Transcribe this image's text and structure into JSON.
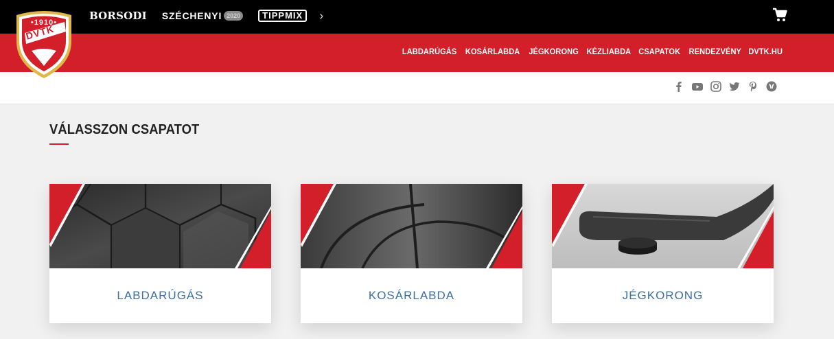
{
  "topbar": {
    "sponsors": {
      "borsodi": "BORSODI",
      "szechenyi": "SZÉCHENYI",
      "szechenyi_badge": "2020",
      "tippmix": "TIPPMIX",
      "more": "›"
    },
    "cart_icon": "shopping-cart-icon"
  },
  "logo": {
    "year": "•1910•",
    "text": "DVTK"
  },
  "nav": {
    "items": [
      {
        "label": "LABDARÚGÁS"
      },
      {
        "label": "KOSÁRLABDA"
      },
      {
        "label": "JÉGKORONG"
      },
      {
        "label": "KÉZLIABDA"
      },
      {
        "label": "CSAPATOK"
      },
      {
        "label": "RENDEZVÉNY"
      },
      {
        "label": "DVTK.HU"
      }
    ]
  },
  "social": {
    "icons": [
      "facebook-icon",
      "youtube-icon",
      "instagram-icon",
      "twitter-icon",
      "pinterest-icon",
      "other-social-icon"
    ]
  },
  "main": {
    "title": "VÁLASSZON CSAPATOT",
    "cards": [
      {
        "label": "LABDARÚGÁS"
      },
      {
        "label": "KOSÁRLABDA"
      },
      {
        "label": "JÉGKORONG"
      }
    ]
  },
  "colors": {
    "brand_red": "#d21f2a",
    "link_blue": "#3b6fa2",
    "logo_gold": "#e0b84a"
  }
}
